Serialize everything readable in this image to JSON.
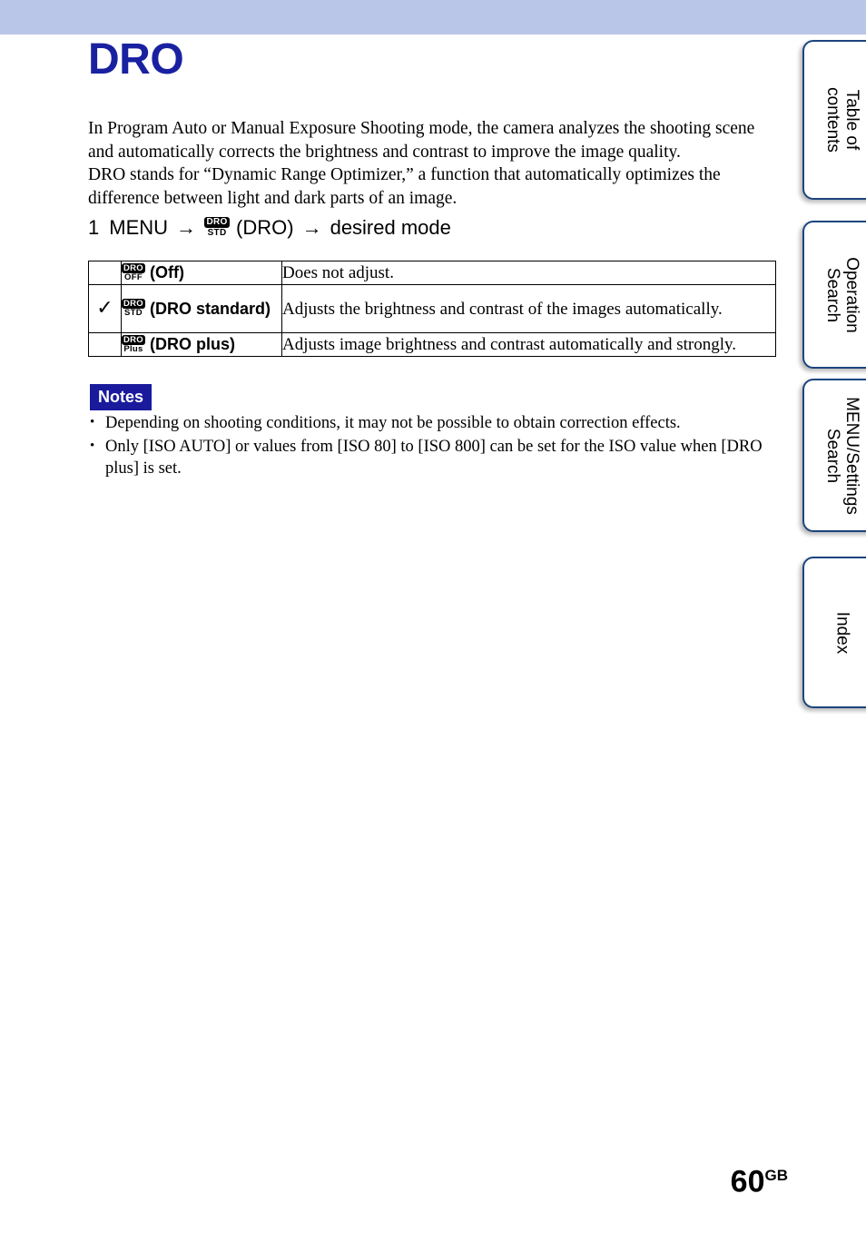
{
  "page": {
    "title": "DRO",
    "number": "60",
    "number_suffix": "GB",
    "title_color": "#1a21a0",
    "band_color": "#b9c6e8"
  },
  "intro": {
    "line1": "In Program Auto or Manual Exposure Shooting mode, the camera analyzes the shooting scene",
    "line2": "and automatically corrects the brightness and contrast to improve the image quality.",
    "line3": "DRO stands for “Dynamic Range Optimizer,” a function that automatically optimizes the",
    "line4": "difference between light and dark parts of an image."
  },
  "step": {
    "number": "1",
    "menu_label": "MENU",
    "arrow1": "→",
    "icon_top": "DRO",
    "icon_bottom": "STD",
    "icon_caption": "(DRO)",
    "arrow2": "→",
    "target": "desired mode"
  },
  "table": {
    "rows": [
      {
        "check": "",
        "icon_top": "DRO",
        "icon_bottom": "OFF",
        "label": "(Off)",
        "description": "Does not adjust."
      },
      {
        "check": "✓",
        "icon_top": "DRO",
        "icon_bottom": "STD",
        "label": "(DRO standard)",
        "description": "Adjusts the brightness and contrast of the images automatically."
      },
      {
        "check": "",
        "icon_top": "DRO",
        "icon_bottom": "Plus",
        "label": "(DRO plus)",
        "description": "Adjusts image brightness and contrast automatically and strongly."
      }
    ]
  },
  "notes": {
    "badge": "Notes",
    "badge_bg": "#1a1a9c",
    "bullet": "•",
    "items": [
      "Depending on shooting conditions, it may not be possible to obtain correction effects.",
      "Only [ISO AUTO] or values from [ISO 80] to [ISO 800] can be set for the ISO value when [DRO plus] is set."
    ]
  },
  "side_tabs": [
    {
      "id": "toc",
      "line1": "Table of",
      "line2": "contents"
    },
    {
      "id": "oper",
      "line1": "Operation",
      "line2": "Search"
    },
    {
      "id": "menu",
      "line1": "MENU/Settings",
      "line2": "Search"
    },
    {
      "id": "index",
      "line1": "Index",
      "line2": ""
    }
  ]
}
